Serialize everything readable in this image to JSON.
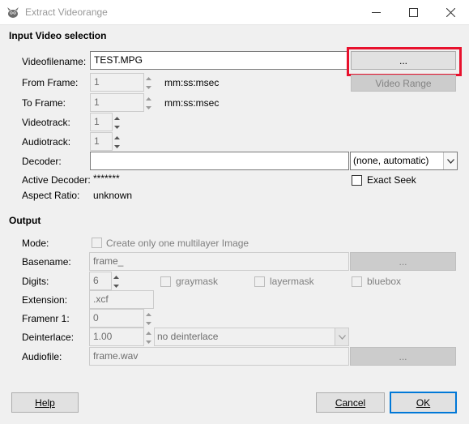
{
  "window": {
    "title": "Extract Videorange"
  },
  "input_section": {
    "heading": "Input Video selection",
    "videofilename_label": "Videofilename:",
    "videofilename_value": "TEST.MPG",
    "browse_label": "...",
    "from_frame_label": "From Frame:",
    "from_frame_value": "1",
    "from_frame_unit": "mm:ss:msec",
    "video_range_label": "Video Range",
    "to_frame_label": "To Frame:",
    "to_frame_value": "1",
    "to_frame_unit": "mm:ss:msec",
    "videotrack_label": "Videotrack:",
    "videotrack_value": "1",
    "audiotrack_label": "Audiotrack:",
    "audiotrack_value": "1",
    "decoder_label": "Decoder:",
    "decoder_value": "",
    "decoder_select_value": "(none, automatic)",
    "active_decoder_label": "Active Decoder:",
    "active_decoder_value": "*******",
    "exact_seek_label": "Exact Seek",
    "exact_seek_checked": false,
    "aspect_ratio_label": "Aspect Ratio:",
    "aspect_ratio_value": "unknown"
  },
  "output_section": {
    "heading": "Output",
    "mode_label": "Mode:",
    "mode_checkbox_label": "Create only one multilayer Image",
    "basename_label": "Basename:",
    "basename_value": "frame_",
    "basename_browse_label": "...",
    "digits_label": "Digits:",
    "digits_value": "6",
    "graymask_label": "graymask",
    "layermask_label": "layermask",
    "bluebox_label": "bluebox",
    "extension_label": "Extension:",
    "extension_value": ".xcf",
    "framenr_label": "Framenr 1:",
    "framenr_value": "0",
    "deinterlace_label": "Deinterlace:",
    "deinterlace_value": "1.00",
    "deinterlace_select_value": "no deinterlace",
    "audiofile_label": "Audiofile:",
    "audiofile_value": "frame.wav",
    "audiofile_browse_label": "..."
  },
  "buttons": {
    "help": "Help",
    "cancel": "Cancel",
    "ok": "OK"
  },
  "colors": {
    "highlight": "#e8112d",
    "default_button_border": "#0078d7"
  }
}
